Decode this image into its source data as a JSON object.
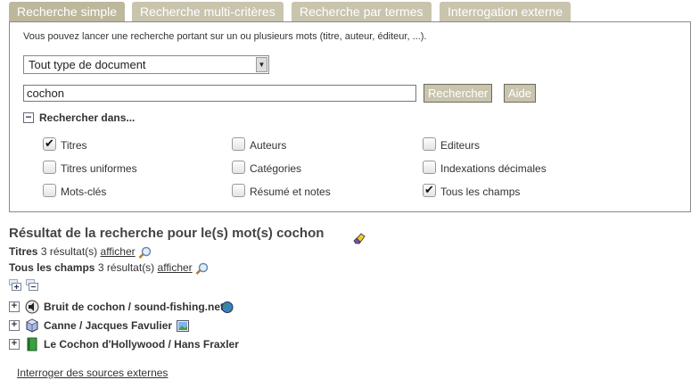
{
  "tabs": [
    "Recherche simple",
    "Recherche multi-critères",
    "Recherche par termes",
    "Interrogation externe"
  ],
  "search": {
    "intro": "Vous pouvez lancer une recherche portant sur un ou plusieurs mots (titre, auteur, éditeur, ...).",
    "doc_type": "Tout type de document",
    "query": "cochon",
    "search_button": "Rechercher",
    "help_button": "Aide",
    "toggle_symbol": "−",
    "search_in_label": "Rechercher dans...",
    "fields": [
      {
        "label": "Titres",
        "checked": true
      },
      {
        "label": "Auteurs",
        "checked": false
      },
      {
        "label": "Editeurs",
        "checked": false
      },
      {
        "label": "Titres uniformes",
        "checked": false
      },
      {
        "label": "Catégories",
        "checked": false
      },
      {
        "label": "Indexations décimales",
        "checked": false
      },
      {
        "label": "Mots-clés",
        "checked": false
      },
      {
        "label": "Résumé et notes",
        "checked": false
      },
      {
        "label": "Tous les champs",
        "checked": true
      }
    ]
  },
  "results": {
    "title": "Résultat de la recherche pour le(s) mot(s) cochon",
    "lines": [
      {
        "field": "Titres",
        "count": "3 résultat(s)",
        "link": "afficher"
      },
      {
        "field": "Tous les champs",
        "count": "3 résultat(s)",
        "link": "afficher"
      }
    ],
    "expand_symbol": "+",
    "items": [
      {
        "title": "Bruit de cochon / sound-fishing.net",
        "type_icon": "sound-icon",
        "extra_icon": "globe-icon"
      },
      {
        "title": "Canne / Jacques Favulier",
        "type_icon": "object-icon",
        "extra_icon": "image-icon"
      },
      {
        "title": "Le Cochon d'Hollywood / Hans Fraxler",
        "type_icon": "book-icon",
        "extra_icon": ""
      }
    ]
  },
  "external_link": "Interroger des sources externes",
  "colors": {
    "tab": "#c9c4ad",
    "tab_active": "#bdb79c",
    "panel_border": "#8a8a8a",
    "text": "#333333"
  }
}
